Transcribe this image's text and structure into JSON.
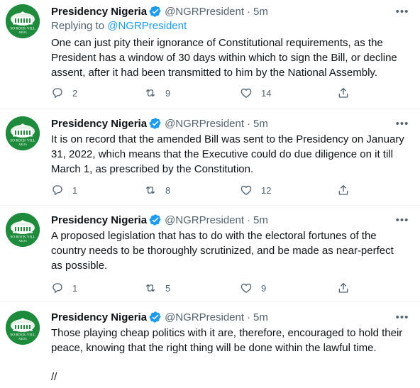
{
  "tweets": [
    {
      "name": "Presidency Nigeria",
      "handle": "@NGRPresident",
      "time": "5m",
      "replying_prefix": "Replying to",
      "replying_handle": "@NGRPresident",
      "text": "One can just pity their ignorance of Constitutional requirements, as the President has a window of 30 days within which to sign the Bill, or decline assent, after it had been transmitted to him by the National Assembly.",
      "replies": "2",
      "retweets": "9",
      "likes": "14"
    },
    {
      "name": "Presidency Nigeria",
      "handle": "@NGRPresident",
      "time": "5m",
      "text": "It is on record that the amended Bill was sent to the Presidency on January 31, 2022, which means that the Executive could do due diligence on it till March 1, as prescribed by the Constitution.",
      "replies": "1",
      "retweets": "8",
      "likes": "12"
    },
    {
      "name": "Presidency Nigeria",
      "handle": "@NGRPresident",
      "time": "5m",
      "text": "A proposed legislation that has to do with the electoral fortunes of the country needs to be thoroughly scrutinized, and be made as near-perfect as possible.",
      "replies": "1",
      "retweets": "5",
      "likes": "9"
    },
    {
      "name": "Presidency Nigeria",
      "handle": "@NGRPresident",
      "time": "5m",
      "text": "Those playing cheap politics with it are, therefore, encouraged to hold their peace, knowing that the right thing will be done within the lawful time.",
      "end_text": "//"
    }
  ],
  "avatar_text": "SO ROCK VILL",
  "avatar_subtext": "ABUJA",
  "colors": {
    "avatar_green": "#1e8a3c",
    "verified_blue": "#1d9bf0",
    "link_blue": "#1d9bf0",
    "muted": "#536471"
  },
  "icons": [
    "verified-badge-icon",
    "more-options-icon",
    "reply-icon",
    "retweet-icon",
    "like-icon",
    "share-icon"
  ]
}
